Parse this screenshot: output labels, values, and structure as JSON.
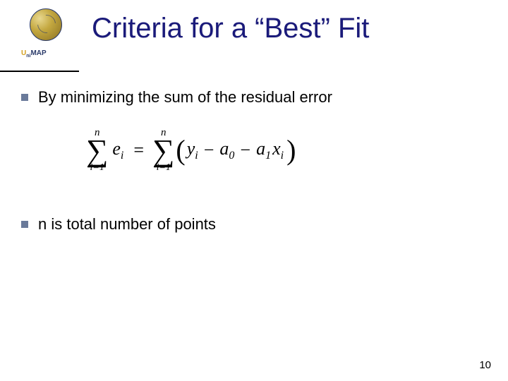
{
  "logo": {
    "text_uni": "U",
    "text_ni": "ni",
    "text_map": "MAP"
  },
  "title": "Criteria for a “Best” Fit",
  "bullets": [
    "By minimizing the sum of the residual error",
    "n is total number of points"
  ],
  "equation": {
    "sum1_upper": "n",
    "sum1_lower": "i=1",
    "term_e": "e",
    "term_e_sub": "i",
    "equals": "=",
    "sum2_upper": "n",
    "sum2_lower": "i=1",
    "lparen": "(",
    "y": "y",
    "y_sub": "i",
    "minus1": "−",
    "a0": "a",
    "a0_sub": "0",
    "minus2": "−",
    "a1": "a",
    "a1_sub": "1",
    "x": "x",
    "x_sub": "i",
    "rparen": ")"
  },
  "page_number": "10"
}
